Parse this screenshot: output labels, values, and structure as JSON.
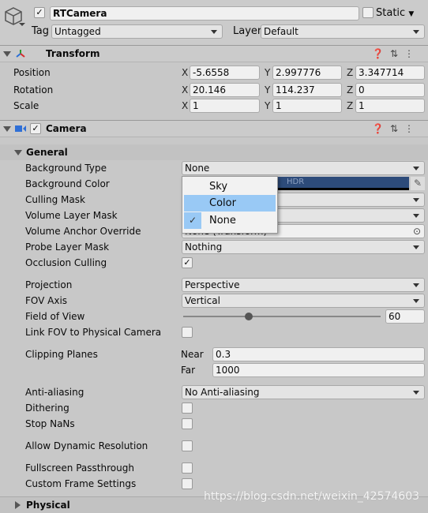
{
  "object": {
    "name": "RTCamera",
    "active": true,
    "static_label": "Static",
    "tag_label": "Tag",
    "tag_value": "Untagged",
    "layer_label": "Layer",
    "layer_value": "Default"
  },
  "transform": {
    "title": "Transform",
    "rows": [
      {
        "label": "Position",
        "x": "-5.6558",
        "y": "2.997776",
        "z": "3.347714"
      },
      {
        "label": "Rotation",
        "x": "20.146",
        "y": "114.237",
        "z": "0"
      },
      {
        "label": "Scale",
        "x": "1",
        "y": "1",
        "z": "1"
      }
    ],
    "axes": [
      "X",
      "Y",
      "Z"
    ]
  },
  "camera": {
    "title": "Camera",
    "enabled": true,
    "general": "General",
    "background_type": {
      "label": "Background Type",
      "value": "None"
    },
    "background_color": {
      "label": "Background Color",
      "hdr": "HDR",
      "color": "#2d4b7a"
    },
    "culling_mask": {
      "label": "Culling Mask"
    },
    "volume_layer_mask": {
      "label": "Volume Layer Mask"
    },
    "volume_anchor_override": {
      "label": "Volume Anchor Override",
      "value": "None (Transform)"
    },
    "probe_layer_mask": {
      "label": "Probe Layer Mask",
      "value": "Nothing"
    },
    "occlusion_culling": {
      "label": "Occlusion Culling",
      "checked": true
    },
    "projection": {
      "label": "Projection",
      "value": "Perspective"
    },
    "fov_axis": {
      "label": "FOV Axis",
      "value": "Vertical"
    },
    "field_of_view": {
      "label": "Field of View",
      "value": "60",
      "slider_fraction": 0.33
    },
    "link_fov": {
      "label": "Link FOV to Physical Camera",
      "checked": false
    },
    "clipping_planes": {
      "label": "Clipping Planes",
      "near_label": "Near",
      "near": "0.3",
      "far_label": "Far",
      "far": "1000"
    },
    "anti_aliasing": {
      "label": "Anti-aliasing",
      "value": "No Anti-aliasing"
    },
    "dithering": {
      "label": "Dithering",
      "checked": false
    },
    "stop_nans": {
      "label": "Stop NaNs",
      "checked": false
    },
    "allow_dynamic_resolution": {
      "label": "Allow Dynamic Resolution",
      "checked": false
    },
    "fullscreen_passthrough": {
      "label": "Fullscreen Passthrough",
      "checked": false
    },
    "custom_frame_settings": {
      "label": "Custom Frame Settings",
      "checked": false
    },
    "physical": "Physical"
  },
  "dropdown_menu": {
    "options": [
      {
        "label": "Sky"
      },
      {
        "label": "Color",
        "highlighted": true
      },
      {
        "label": "None",
        "selected": true
      }
    ],
    "highlight_color": "#99c9f5"
  },
  "watermark": "https://blog.csdn.net/weixin_42574603"
}
